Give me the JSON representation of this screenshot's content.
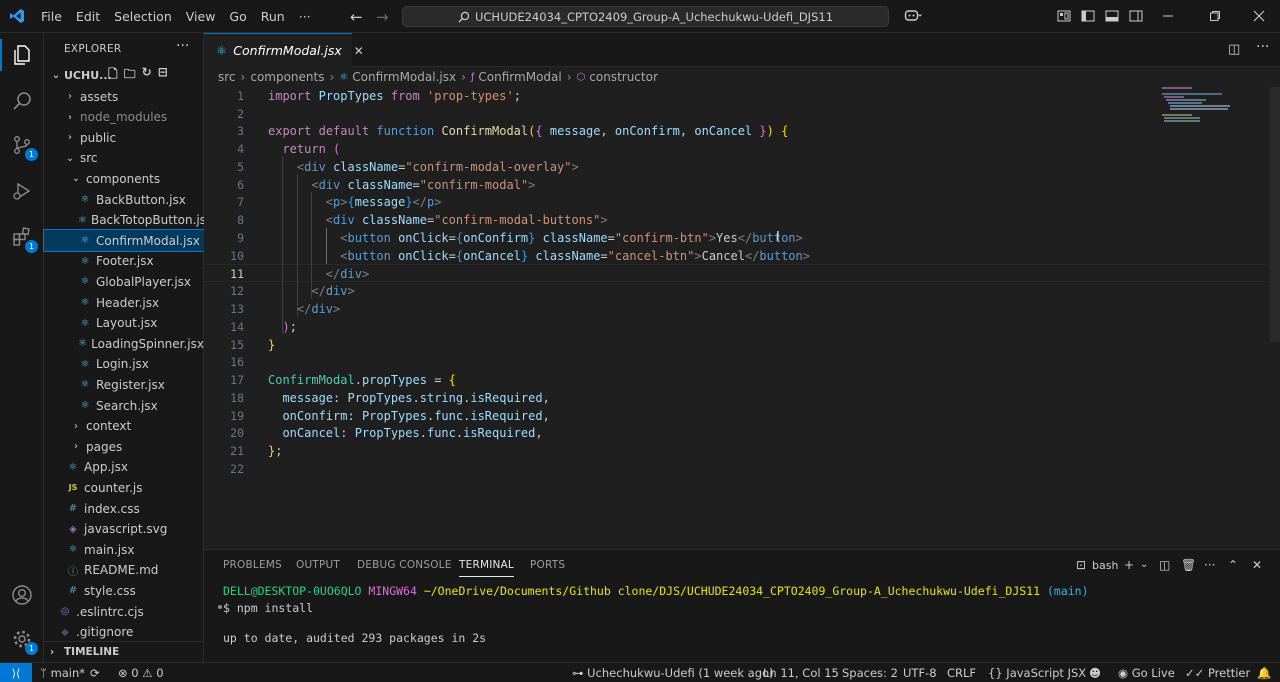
{
  "title": {
    "menus": [
      "File",
      "Edit",
      "Selection",
      "View",
      "Go",
      "Run",
      "···"
    ],
    "command_center": "UCHUDE24034_CPTO2409_Group-A_Uchechukwu-Udefi_DJS11"
  },
  "activity": {
    "scm_badge": "1",
    "extensions_badge": "1",
    "accounts_badge": "1"
  },
  "sidebar": {
    "title": "EXPLORER",
    "more": "···",
    "root": "UCHU...",
    "items": [
      {
        "label": "assets",
        "kind": "folder"
      },
      {
        "label": "node_modules",
        "kind": "folder"
      },
      {
        "label": "public",
        "kind": "folder"
      },
      {
        "label": "src",
        "kind": "folder-open"
      },
      {
        "label": "components",
        "kind": "folder-open"
      },
      {
        "label": "BackButton.jsx",
        "kind": "jsx"
      },
      {
        "label": "BackTotopButton.jsx",
        "kind": "jsx"
      },
      {
        "label": "ConfirmModal.jsx",
        "kind": "jsx"
      },
      {
        "label": "Footer.jsx",
        "kind": "jsx"
      },
      {
        "label": "GlobalPlayer.jsx",
        "kind": "jsx"
      },
      {
        "label": "Header.jsx",
        "kind": "jsx"
      },
      {
        "label": "Layout.jsx",
        "kind": "jsx"
      },
      {
        "label": "LoadingSpinner.jsx",
        "kind": "jsx"
      },
      {
        "label": "Login.jsx",
        "kind": "jsx"
      },
      {
        "label": "Register.jsx",
        "kind": "jsx"
      },
      {
        "label": "Search.jsx",
        "kind": "jsx"
      },
      {
        "label": "context",
        "kind": "folder"
      },
      {
        "label": "pages",
        "kind": "folder"
      },
      {
        "label": "App.jsx",
        "kind": "jsx"
      },
      {
        "label": "counter.js",
        "kind": "js"
      },
      {
        "label": "index.css",
        "kind": "css"
      },
      {
        "label": "javascript.svg",
        "kind": "svg"
      },
      {
        "label": "main.jsx",
        "kind": "jsx"
      },
      {
        "label": "README.md",
        "kind": "md"
      },
      {
        "label": "style.css",
        "kind": "css"
      },
      {
        "label": ".eslintrc.cjs",
        "kind": "eslint"
      },
      {
        "label": ".gitignore",
        "kind": "git"
      }
    ],
    "timeline": "TIMELINE"
  },
  "editor": {
    "tab": "ConfirmModal.jsx",
    "breadcrumb": [
      "src",
      "components",
      "ConfirmModal.jsx",
      "ConfirmModal",
      "constructor"
    ],
    "current_line": 11,
    "line_numbers": [
      "1",
      "2",
      "3",
      "4",
      "5",
      "6",
      "7",
      "8",
      "9",
      "10",
      "11",
      "12",
      "13",
      "14",
      "15",
      "16",
      "17",
      "18",
      "19",
      "20",
      "21",
      "22"
    ]
  },
  "panel": {
    "tabs": [
      "PROBLEMS",
      "OUTPUT",
      "DEBUG CONSOLE",
      "TERMINAL",
      "PORTS"
    ],
    "active_tab": "TERMINAL",
    "shell": "bash",
    "prompt_user": "DELL@DESKTOP-0UO6QLO",
    "prompt_env": "MINGW64",
    "prompt_path": "~/OneDrive/Documents/Github clone/DJS/UCHUDE24034_CPTO2409_Group-A_Uchechukwu-Udefi_DJS11",
    "prompt_branch": "(main)",
    "command": "$ npm install",
    "output": "up to date, audited 293 packages in 2s"
  },
  "status": {
    "branch": "main*",
    "errors": "0",
    "warnings": "0",
    "blame": "Uchechukwu-Udefi (1 week ago)",
    "position": "Ln 11, Col 15",
    "spaces": "Spaces: 2",
    "encoding": "UTF-8",
    "eol": "CRLF",
    "language": "JavaScript JSX",
    "golive": "Go Live",
    "prettier": "Prettier"
  },
  "colors": {
    "accent": "#0078d4",
    "background": "#1f1f1f",
    "chrome": "#181818"
  }
}
